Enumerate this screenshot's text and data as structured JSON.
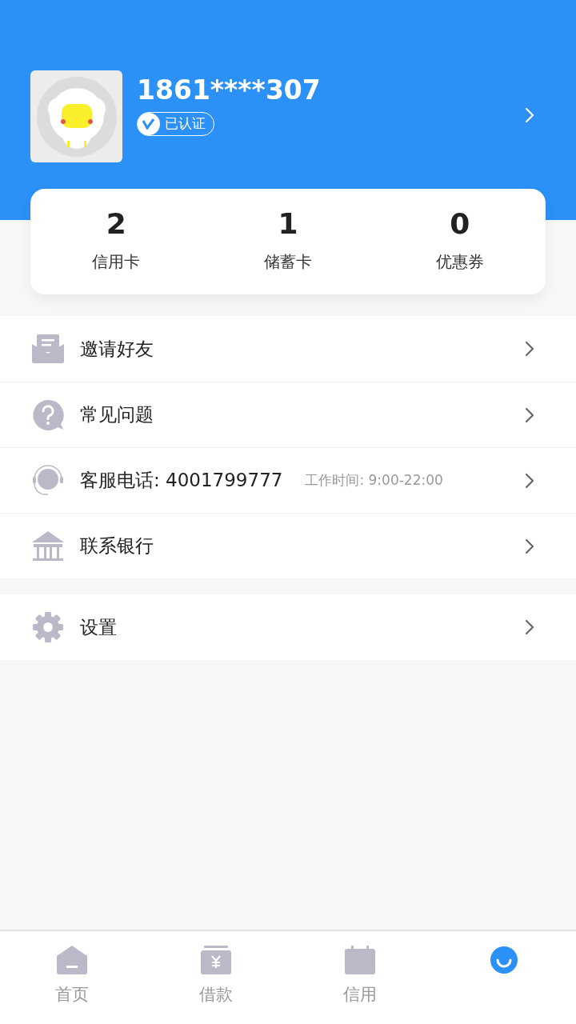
{
  "profile": {
    "phone": "1861****307",
    "badge": "已认证"
  },
  "stats": [
    {
      "value": "2",
      "label": "信用卡"
    },
    {
      "value": "1",
      "label": "储蓄卡"
    },
    {
      "value": "0",
      "label": "优惠券"
    }
  ],
  "menu_groups": [
    [
      {
        "kind": "invite",
        "label": "邀请好友"
      },
      {
        "kind": "faq",
        "label": "常见问题"
      },
      {
        "kind": "service",
        "label": "客服电话: 4001799777",
        "note": "工作时间: 9:00-22:00"
      },
      {
        "kind": "bank",
        "label": "联系银行"
      }
    ],
    [
      {
        "kind": "settings",
        "label": "设置"
      }
    ]
  ],
  "tab_bar": [
    {
      "kind": "home",
      "label": "首页",
      "selected": false
    },
    {
      "kind": "loan",
      "label": "借款",
      "selected": false
    },
    {
      "kind": "card",
      "label": "信用",
      "selected": false
    },
    {
      "kind": "me",
      "selected": true
    }
  ]
}
